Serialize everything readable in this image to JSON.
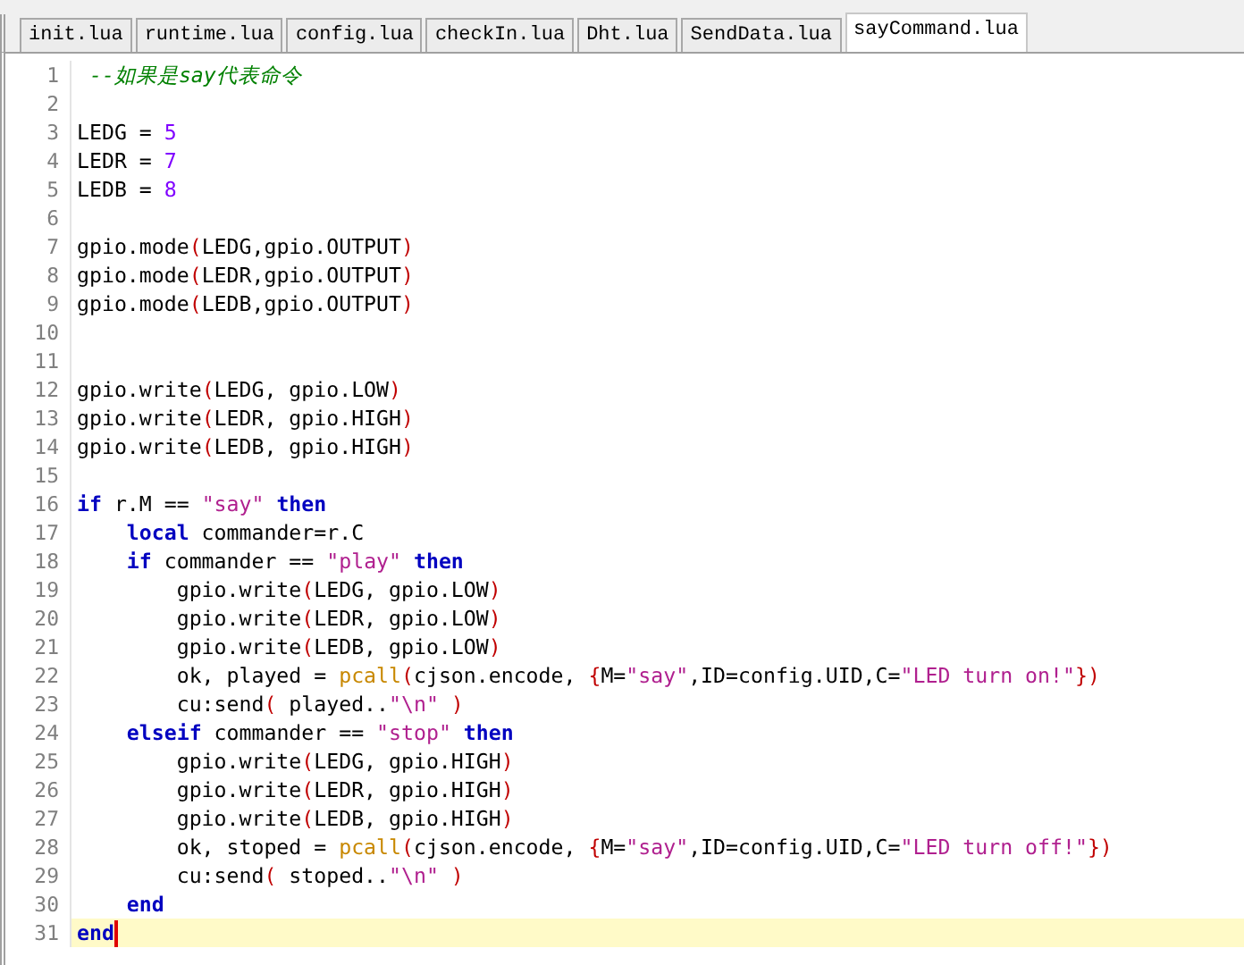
{
  "tabs": [
    {
      "label": "init.lua",
      "selected": false
    },
    {
      "label": "runtime.lua",
      "selected": false
    },
    {
      "label": "config.lua",
      "selected": false
    },
    {
      "label": "checkIn.lua",
      "selected": false
    },
    {
      "label": "Dht.lua",
      "selected": false
    },
    {
      "label": "SendData.lua",
      "selected": false
    },
    {
      "label": "sayCommand.lua",
      "selected": true
    }
  ],
  "editor": {
    "lines": [
      {
        "number": "1",
        "current": false,
        "tokens": [
          {
            "text": " --如果是say代表命令",
            "kind": "comment"
          }
        ]
      },
      {
        "number": "2",
        "current": false
      },
      {
        "number": "3",
        "current": false,
        "tokens": [
          {
            "text": "LEDG = ",
            "kind": "text"
          },
          {
            "text": "5",
            "kind": "number"
          }
        ]
      },
      {
        "number": "4",
        "current": false,
        "tokens": [
          {
            "text": "LEDR = ",
            "kind": "text"
          },
          {
            "text": "7",
            "kind": "number"
          }
        ]
      },
      {
        "number": "5",
        "current": false,
        "tokens": [
          {
            "text": "LEDB = ",
            "kind": "text"
          },
          {
            "text": "8",
            "kind": "number"
          }
        ]
      },
      {
        "number": "6",
        "current": false
      },
      {
        "number": "7",
        "current": false,
        "tokens": [
          {
            "text": "gpio.mode",
            "kind": "text"
          },
          {
            "text": "(",
            "kind": "operator"
          },
          {
            "text": "LEDG,gpio.OUTPUT",
            "kind": "text"
          },
          {
            "text": ")",
            "kind": "operator"
          }
        ]
      },
      {
        "number": "8",
        "current": false,
        "tokens": [
          {
            "text": "gpio.mode",
            "kind": "text"
          },
          {
            "text": "(",
            "kind": "operator"
          },
          {
            "text": "LEDR,gpio.OUTPUT",
            "kind": "text"
          },
          {
            "text": ")",
            "kind": "operator"
          }
        ]
      },
      {
        "number": "9",
        "current": false,
        "tokens": [
          {
            "text": "gpio.mode",
            "kind": "text"
          },
          {
            "text": "(",
            "kind": "operator"
          },
          {
            "text": "LEDB,gpio.OUTPUT",
            "kind": "text"
          },
          {
            "text": ")",
            "kind": "operator"
          }
        ]
      },
      {
        "number": "10",
        "current": false
      },
      {
        "number": "11",
        "current": false
      },
      {
        "number": "12",
        "current": false,
        "tokens": [
          {
            "text": "gpio.write",
            "kind": "text"
          },
          {
            "text": "(",
            "kind": "operator"
          },
          {
            "text": "LEDG, gpio.LOW",
            "kind": "text"
          },
          {
            "text": ")",
            "kind": "operator"
          }
        ]
      },
      {
        "number": "13",
        "current": false,
        "tokens": [
          {
            "text": "gpio.write",
            "kind": "text"
          },
          {
            "text": "(",
            "kind": "operator"
          },
          {
            "text": "LEDR, gpio.HIGH",
            "kind": "text"
          },
          {
            "text": ")",
            "kind": "operator"
          }
        ]
      },
      {
        "number": "14",
        "current": false,
        "tokens": [
          {
            "text": "gpio.write",
            "kind": "text"
          },
          {
            "text": "(",
            "kind": "operator"
          },
          {
            "text": "LEDB, gpio.HIGH",
            "kind": "text"
          },
          {
            "text": ")",
            "kind": "operator"
          }
        ]
      },
      {
        "number": "15",
        "current": false
      },
      {
        "number": "16",
        "current": false,
        "tokens": [
          {
            "text": "if",
            "kind": "keyword"
          },
          {
            "text": " r.M == ",
            "kind": "text"
          },
          {
            "text": "\"say\"",
            "kind": "string"
          },
          {
            "text": " then",
            "kind": "keyword"
          }
        ]
      },
      {
        "number": "17",
        "current": false,
        "tokens": [
          {
            "text": "    local",
            "kind": "keyword"
          },
          {
            "text": " commander=r.C",
            "kind": "text"
          }
        ]
      },
      {
        "number": "18",
        "current": false,
        "tokens": [
          {
            "text": "    if",
            "kind": "keyword"
          },
          {
            "text": " commander == ",
            "kind": "text"
          },
          {
            "text": "\"play\"",
            "kind": "string"
          },
          {
            "text": " then",
            "kind": "keyword"
          }
        ]
      },
      {
        "number": "19",
        "current": false,
        "tokens": [
          {
            "text": "        gpio.write",
            "kind": "text"
          },
          {
            "text": "(",
            "kind": "operator"
          },
          {
            "text": "LEDG, gpio.LOW",
            "kind": "text"
          },
          {
            "text": ")",
            "kind": "operator"
          }
        ]
      },
      {
        "number": "20",
        "current": false,
        "tokens": [
          {
            "text": "        gpio.write",
            "kind": "text"
          },
          {
            "text": "(",
            "kind": "operator"
          },
          {
            "text": "LEDR, gpio.LOW",
            "kind": "text"
          },
          {
            "text": ")",
            "kind": "operator"
          }
        ]
      },
      {
        "number": "21",
        "current": false,
        "tokens": [
          {
            "text": "        gpio.write",
            "kind": "text"
          },
          {
            "text": "(",
            "kind": "operator"
          },
          {
            "text": "LEDB, gpio.LOW",
            "kind": "text"
          },
          {
            "text": ")",
            "kind": "operator"
          }
        ]
      },
      {
        "number": "22",
        "current": false,
        "tokens": [
          {
            "text": "        ok, played = ",
            "kind": "text"
          },
          {
            "text": "pcall",
            "kind": "builtin"
          },
          {
            "text": "(",
            "kind": "operator"
          },
          {
            "text": "cjson.encode, ",
            "kind": "text"
          },
          {
            "text": "{",
            "kind": "operator"
          },
          {
            "text": "M=",
            "kind": "text"
          },
          {
            "text": "\"say\"",
            "kind": "string"
          },
          {
            "text": ",ID=config.UID,C=",
            "kind": "text"
          },
          {
            "text": "\"LED turn on!\"",
            "kind": "string"
          },
          {
            "text": "})",
            "kind": "operator"
          }
        ]
      },
      {
        "number": "23",
        "current": false,
        "tokens": [
          {
            "text": "        cu:send",
            "kind": "text"
          },
          {
            "text": "(",
            "kind": "operator"
          },
          {
            "text": " played..",
            "kind": "text"
          },
          {
            "text": "\"\\n\"",
            "kind": "string"
          },
          {
            "text": " )",
            "kind": "operator"
          }
        ]
      },
      {
        "number": "24",
        "current": false,
        "tokens": [
          {
            "text": "    elseif",
            "kind": "keyword"
          },
          {
            "text": " commander == ",
            "kind": "text"
          },
          {
            "text": "\"stop\"",
            "kind": "string"
          },
          {
            "text": " then",
            "kind": "keyword"
          }
        ]
      },
      {
        "number": "25",
        "current": false,
        "tokens": [
          {
            "text": "        gpio.write",
            "kind": "text"
          },
          {
            "text": "(",
            "kind": "operator"
          },
          {
            "text": "LEDG, gpio.HIGH",
            "kind": "text"
          },
          {
            "text": ")",
            "kind": "operator"
          }
        ]
      },
      {
        "number": "26",
        "current": false,
        "tokens": [
          {
            "text": "        gpio.write",
            "kind": "text"
          },
          {
            "text": "(",
            "kind": "operator"
          },
          {
            "text": "LEDR, gpio.HIGH",
            "kind": "text"
          },
          {
            "text": ")",
            "kind": "operator"
          }
        ]
      },
      {
        "number": "27",
        "current": false,
        "tokens": [
          {
            "text": "        gpio.write",
            "kind": "text"
          },
          {
            "text": "(",
            "kind": "operator"
          },
          {
            "text": "LEDB, gpio.HIGH",
            "kind": "text"
          },
          {
            "text": ")",
            "kind": "operator"
          }
        ]
      },
      {
        "number": "28",
        "current": false,
        "tokens": [
          {
            "text": "        ok, stoped = ",
            "kind": "text"
          },
          {
            "text": "pcall",
            "kind": "builtin"
          },
          {
            "text": "(",
            "kind": "operator"
          },
          {
            "text": "cjson.encode, ",
            "kind": "text"
          },
          {
            "text": "{",
            "kind": "operator"
          },
          {
            "text": "M=",
            "kind": "text"
          },
          {
            "text": "\"say\"",
            "kind": "string"
          },
          {
            "text": ",ID=config.UID,C=",
            "kind": "text"
          },
          {
            "text": "\"LED turn off!\"",
            "kind": "string"
          },
          {
            "text": "})",
            "kind": "operator"
          }
        ]
      },
      {
        "number": "29",
        "current": false,
        "tokens": [
          {
            "text": "        cu:send",
            "kind": "text"
          },
          {
            "text": "(",
            "kind": "operator"
          },
          {
            "text": " stoped..",
            "kind": "text"
          },
          {
            "text": "\"\\n\"",
            "kind": "string"
          },
          {
            "text": " )",
            "kind": "operator"
          }
        ]
      },
      {
        "number": "30",
        "current": false,
        "tokens": [
          {
            "text": "    end",
            "kind": "keyword"
          }
        ]
      },
      {
        "number": "31",
        "current": true,
        "tokens": [
          {
            "text": "end",
            "kind": "keyword"
          }
        ]
      }
    ]
  }
}
